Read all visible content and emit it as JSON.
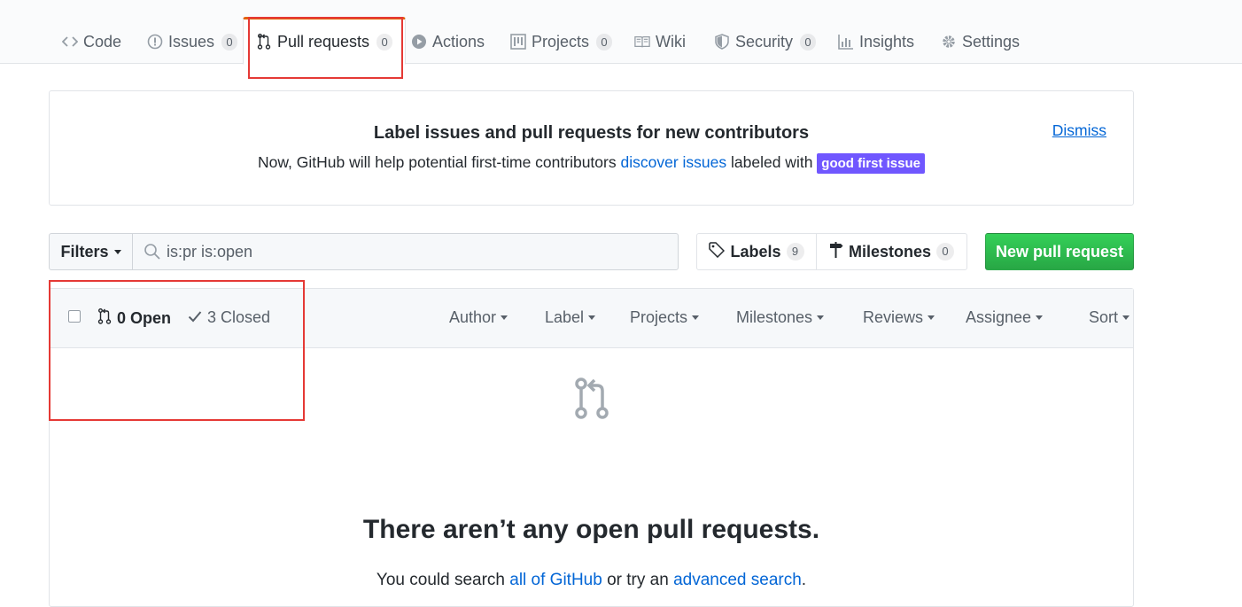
{
  "tabs": [
    {
      "label": "Code",
      "icon": "code-icon"
    },
    {
      "label": "Issues",
      "count": "0",
      "icon": "issue-icon"
    },
    {
      "label": "Pull requests",
      "count": "0",
      "icon": "pull-request-icon",
      "selected": true
    },
    {
      "label": "Actions",
      "icon": "play-icon"
    },
    {
      "label": "Projects",
      "count": "0",
      "icon": "project-icon"
    },
    {
      "label": "Wiki",
      "icon": "book-icon"
    },
    {
      "label": "Security",
      "count": "0",
      "icon": "shield-icon"
    },
    {
      "label": "Insights",
      "icon": "graph-icon"
    },
    {
      "label": "Settings",
      "icon": "gear-icon"
    }
  ],
  "banner": {
    "title": "Label issues and pull requests for new contributors",
    "text_before": "Now, GitHub will help potential first-time contributors",
    "link": "discover issues",
    "text_after": "labeled with",
    "label": "good first issue",
    "dismiss": "Dismiss"
  },
  "filters": {
    "button": "Filters",
    "search_value": "is:pr is:open"
  },
  "labels_button": {
    "label": "Labels",
    "count": "9"
  },
  "milestones_button": {
    "label": "Milestones",
    "count": "0"
  },
  "new_pr_button": "New pull request",
  "states": {
    "open": "0 Open",
    "closed": "3 Closed"
  },
  "sorters": [
    "Author",
    "Label",
    "Projects",
    "Milestones",
    "Reviews",
    "Assignee",
    "Sort"
  ],
  "blankslate": {
    "title": "There aren’t any open pull requests.",
    "text_before": "You could search",
    "link1": "all of GitHub",
    "text_middle": "or try an",
    "link2": "advanced search",
    "text_after": "."
  },
  "colors": {
    "accent": "#0366d6",
    "green": "#28a745",
    "tab_highlight": "#e36209",
    "annotation": "#e53935",
    "label_purple": "#7057ff"
  }
}
